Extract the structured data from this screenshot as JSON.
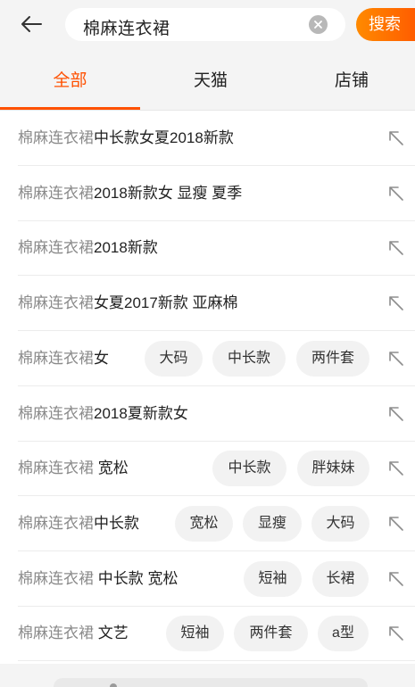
{
  "search": {
    "query": "棉麻连衣裙",
    "button_label": "搜索"
  },
  "tabs": [
    {
      "label": "全部",
      "active": true
    },
    {
      "label": "天猫",
      "active": false
    },
    {
      "label": "店铺",
      "active": false
    }
  ],
  "colors": {
    "accent": "#ff5000",
    "accent_gradient_start": "#ff8a00",
    "prefix_text": "#8a8a8a",
    "chip_bg": "#f2f2f2"
  },
  "suggestions": [
    {
      "prefix": "棉麻连衣裙",
      "suffix": "中长款女夏2018新款",
      "chips": []
    },
    {
      "prefix": "棉麻连衣裙",
      "suffix": "2018新款女 显瘦 夏季",
      "chips": []
    },
    {
      "prefix": "棉麻连衣裙",
      "suffix": "2018新款",
      "chips": []
    },
    {
      "prefix": "棉麻连衣裙",
      "suffix": "女夏2017新款 亚麻棉",
      "chips": []
    },
    {
      "prefix": "棉麻连衣裙",
      "suffix": "女",
      "chips": [
        "大码",
        "中长款",
        "两件套"
      ]
    },
    {
      "prefix": "棉麻连衣裙",
      "suffix": "2018夏新款女",
      "chips": []
    },
    {
      "prefix": "棉麻连衣裙",
      "suffix": " 宽松",
      "chips": [
        "中长款",
        "胖妹妹"
      ]
    },
    {
      "prefix": "棉麻连衣裙",
      "suffix": "中长款",
      "chips": [
        "宽松",
        "显瘦",
        "大码"
      ]
    },
    {
      "prefix": "棉麻连衣裙",
      "suffix": " 中长款 宽松",
      "chips": [
        "短袖",
        "长裙"
      ]
    },
    {
      "prefix": "棉麻连衣裙",
      "suffix": " 文艺",
      "chips": [
        "短袖",
        "两件套",
        "a型"
      ]
    }
  ]
}
